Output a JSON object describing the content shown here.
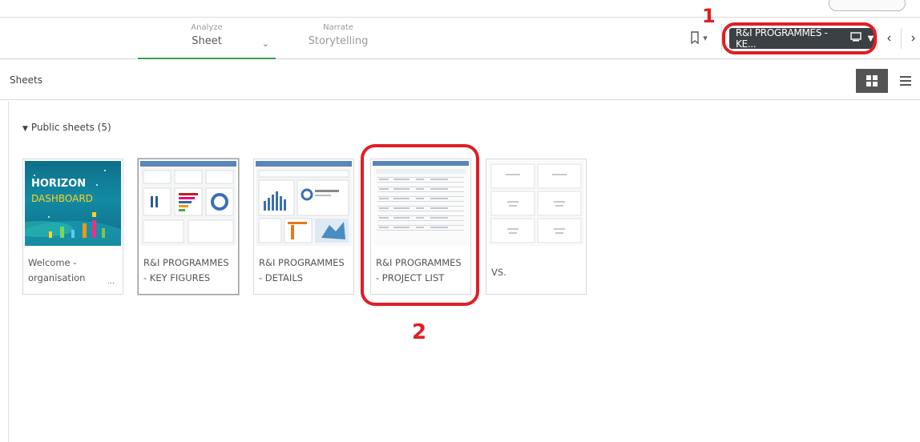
{
  "toolbar": {
    "analyze_small": "Analyze",
    "analyze_main": "Sheet",
    "narrate_small": "Narrate",
    "narrate_main": "Storytelling",
    "current_sheet": "R&I PROGRAMMES - KE..."
  },
  "annotations": {
    "marker_1": "1",
    "marker_2": "2"
  },
  "sheets": {
    "title": "Sheets",
    "section_label": "Public sheets (5)",
    "cards": [
      {
        "title_line1": "Welcome -",
        "title_line2": "organisation",
        "menu": "...",
        "thumb_line1": "HORIZON",
        "thumb_line2": "DASHBOARD"
      },
      {
        "title_line1": "R&I PROGRAMMES",
        "title_line2": "- KEY FIGURES"
      },
      {
        "title_line1": "R&I PROGRAMMES",
        "title_line2": "- DETAILS"
      },
      {
        "title_line1": "R&I PROGRAMMES",
        "title_line2": "- PROJECT LIST"
      },
      {
        "title_line1": "VS.",
        "title_line2": ""
      }
    ]
  },
  "colors": {
    "accent_green": "#3a9b58",
    "highlight_red": "#e01e24",
    "dark_select": "#3b4044"
  },
  "icons": [
    "bookmark-icon",
    "caret-down-icon",
    "sheet-icon",
    "chevron-left-icon",
    "chevron-right-icon",
    "grid-view-icon",
    "list-view-icon"
  ]
}
